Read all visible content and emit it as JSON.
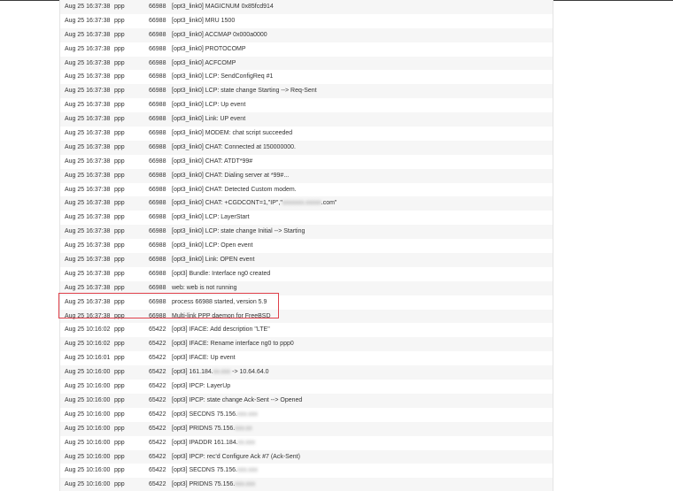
{
  "log": {
    "rows": [
      {
        "time": "Aug 25 16:37:38",
        "process": "ppp",
        "pid": "66988",
        "message": "[opt3_link0] MAGICNUM 0x85fcd914"
      },
      {
        "time": "Aug 25 16:37:38",
        "process": "ppp",
        "pid": "66988",
        "message": "[opt3_link0] MRU 1500"
      },
      {
        "time": "Aug 25 16:37:38",
        "process": "ppp",
        "pid": "66988",
        "message": "[opt3_link0] ACCMAP 0x000a0000"
      },
      {
        "time": "Aug 25 16:37:38",
        "process": "ppp",
        "pid": "66988",
        "message": "[opt3_link0] PROTOCOMP"
      },
      {
        "time": "Aug 25 16:37:38",
        "process": "ppp",
        "pid": "66988",
        "message": "[opt3_link0] ACFCOMP"
      },
      {
        "time": "Aug 25 16:37:38",
        "process": "ppp",
        "pid": "66988",
        "message": "[opt3_link0] LCP: SendConfigReq #1"
      },
      {
        "time": "Aug 25 16:37:38",
        "process": "ppp",
        "pid": "66988",
        "message": "[opt3_link0] LCP: state change Starting --> Req-Sent"
      },
      {
        "time": "Aug 25 16:37:38",
        "process": "ppp",
        "pid": "66988",
        "message": "[opt3_link0] LCP: Up event"
      },
      {
        "time": "Aug 25 16:37:38",
        "process": "ppp",
        "pid": "66988",
        "message": "[opt3_link0] Link: UP event"
      },
      {
        "time": "Aug 25 16:37:38",
        "process": "ppp",
        "pid": "66988",
        "message": "[opt3_link0] MODEM: chat script succeeded"
      },
      {
        "time": "Aug 25 16:37:38",
        "process": "ppp",
        "pid": "66988",
        "message": "[opt3_link0] CHAT: Connected at 150000000."
      },
      {
        "time": "Aug 25 16:37:38",
        "process": "ppp",
        "pid": "66988",
        "message": "[opt3_link0] CHAT: ATDT*99#"
      },
      {
        "time": "Aug 25 16:37:38",
        "process": "ppp",
        "pid": "66988",
        "message": "[opt3_link0] CHAT: Dialing server at *99#..."
      },
      {
        "time": "Aug 25 16:37:38",
        "process": "ppp",
        "pid": "66988",
        "message": "[opt3_link0] CHAT: Detected Custom modem."
      },
      {
        "time": "Aug 25 16:37:38",
        "process": "ppp",
        "pid": "66988",
        "message": "[opt3_link0] CHAT: +CGDCONT=1,\"IP\",\"",
        "blurred": "xxxxxxx.xxxxx",
        "message_after": ".com\""
      },
      {
        "time": "Aug 25 16:37:38",
        "process": "ppp",
        "pid": "66988",
        "message": "[opt3_link0] LCP: LayerStart"
      },
      {
        "time": "Aug 25 16:37:38",
        "process": "ppp",
        "pid": "66988",
        "message": "[opt3_link0] LCP: state change Initial --> Starting"
      },
      {
        "time": "Aug 25 16:37:38",
        "process": "ppp",
        "pid": "66988",
        "message": "[opt3_link0] LCP: Open event"
      },
      {
        "time": "Aug 25 16:37:38",
        "process": "ppp",
        "pid": "66988",
        "message": "[opt3_link0] Link: OPEN event"
      },
      {
        "time": "Aug 25 16:37:38",
        "process": "ppp",
        "pid": "66988",
        "message": "[opt3] Bundle: Interface ng0 created"
      },
      {
        "time": "Aug 25 16:37:38",
        "process": "ppp",
        "pid": "66988",
        "message": "web: web is not running"
      },
      {
        "time": "Aug 25 16:37:38",
        "process": "ppp",
        "pid": "66988",
        "message": "process 66988 started, version 5.9"
      },
      {
        "time": "Aug 25 16:37:38",
        "process": "ppp",
        "pid": "66988",
        "message": "Multi-link PPP daemon for FreeBSD"
      },
      {
        "time": "Aug 25 10:16:02",
        "process": "ppp",
        "pid": "65422",
        "message": "[opt3] IFACE: Add description \"LTE\""
      },
      {
        "time": "Aug 25 10:16:02",
        "process": "ppp",
        "pid": "65422",
        "message": "[opt3] IFACE: Rename interface ng0 to ppp0"
      },
      {
        "time": "Aug 25 10:16:01",
        "process": "ppp",
        "pid": "65422",
        "message": "[opt3] IFACE: Up event"
      },
      {
        "time": "Aug 25 10:16:00",
        "process": "ppp",
        "pid": "65422",
        "message": "[opt3] 161.184.",
        "blurred": "xx.xxx",
        "message_after": " -> 10.64.64.0"
      },
      {
        "time": "Aug 25 10:16:00",
        "process": "ppp",
        "pid": "65422",
        "message": "[opt3] IPCP: LayerUp"
      },
      {
        "time": "Aug 25 10:16:00",
        "process": "ppp",
        "pid": "65422",
        "message": "[opt3] IPCP: state change Ack-Sent --> Opened"
      },
      {
        "time": "Aug 25 10:16:00",
        "process": "ppp",
        "pid": "65422",
        "message": "[opt3] SECDNS 75.156.",
        "blurred": "xxx.xxx",
        "message_after": ""
      },
      {
        "time": "Aug 25 10:16:00",
        "process": "ppp",
        "pid": "65422",
        "message": "[opt3] PRIDNS 75.156.",
        "blurred": "xxx.xx",
        "message_after": ""
      },
      {
        "time": "Aug 25 10:16:00",
        "process": "ppp",
        "pid": "65422",
        "message": "[opt3] IPADDR 161.184.",
        "blurred": "xx.xxx",
        "message_after": ""
      },
      {
        "time": "Aug 25 10:16:00",
        "process": "ppp",
        "pid": "65422",
        "message": "[opt3] IPCP: rec'd Configure Ack #7 (Ack-Sent)"
      },
      {
        "time": "Aug 25 10:16:00",
        "process": "ppp",
        "pid": "65422",
        "message": "[opt3] SECDNS 75.156.",
        "blurred": "xxx.xxx",
        "message_after": ""
      },
      {
        "time": "Aug 25 10:16:00",
        "process": "ppp",
        "pid": "65422",
        "message": "[opt3] PRIDNS 75.156.",
        "blurred": "xxx.xxx",
        "message_after": ""
      }
    ]
  },
  "highlight": {
    "color": "#e0404a"
  }
}
